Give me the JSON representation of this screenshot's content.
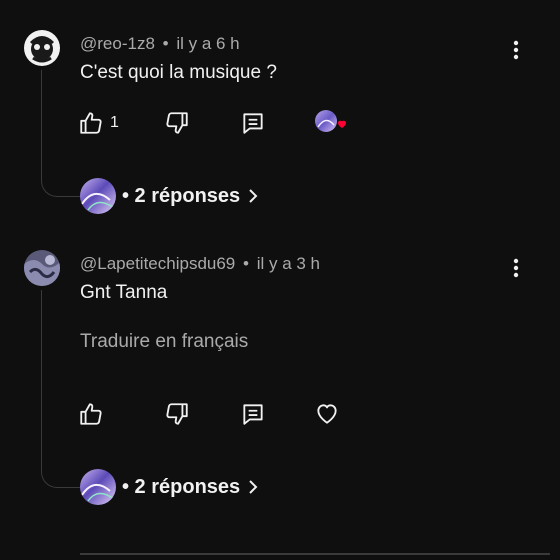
{
  "comments": [
    {
      "author": "@reo-1z8",
      "separator": "•",
      "time": "il y a 6 h",
      "text": "C'est quoi la musique ?",
      "like_count": "1",
      "replies_label": "• 2 réponses"
    },
    {
      "author": "@Lapetitechipsdu69",
      "separator": "•",
      "time": "il y a 3 h",
      "text": "Gnt Tanna",
      "translate_label": "Traduire en français",
      "replies_label": "• 2 réponses"
    }
  ],
  "icons": {
    "like": "thumb-up-icon",
    "dislike": "thumb-down-icon",
    "reply": "reply-comment-icon",
    "heart": "heart-outline-icon",
    "more": "more-vertical-icon",
    "chevron": "chevron-right-icon",
    "creator_heart": "creator-heart-icon"
  },
  "colors": {
    "background": "#0f0f0f",
    "text": "#f1f1f1",
    "secondary_text": "#aaaaaa",
    "heart_red": "#ff0033"
  }
}
